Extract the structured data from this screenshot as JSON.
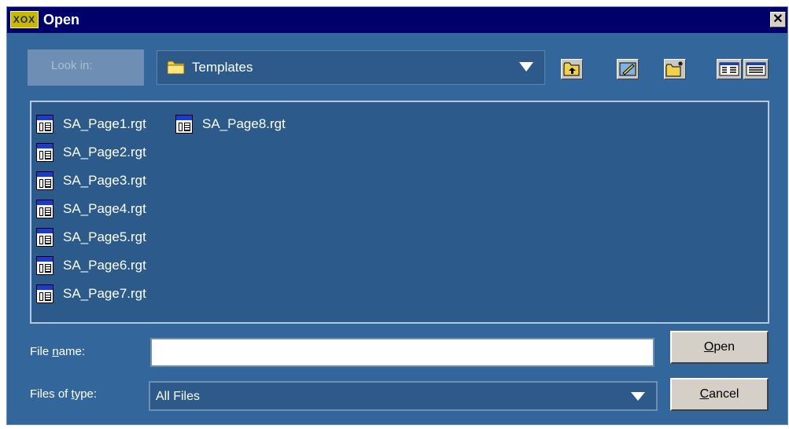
{
  "window": {
    "title": "Open",
    "app_icon_text": "XOX",
    "close_glyph": "✕"
  },
  "lookin": {
    "label": "Look in:",
    "value": "Templates",
    "icon": "folder-icon"
  },
  "toolbar": {
    "buttons": [
      "up-one-level-icon",
      "desktop-icon",
      "new-folder-icon",
      "list-view-icon",
      "details-view-icon"
    ]
  },
  "files": [
    {
      "name": "SA_Page1.rgt"
    },
    {
      "name": "SA_Page2.rgt"
    },
    {
      "name": "SA_Page3.rgt"
    },
    {
      "name": "SA_Page4.rgt"
    },
    {
      "name": "SA_Page5.rgt"
    },
    {
      "name": "SA_Page6.rgt"
    },
    {
      "name": "SA_Page7.rgt"
    },
    {
      "name": "SA_Page8.rgt"
    }
  ],
  "filename": {
    "label_pre": "File ",
    "label_u": "n",
    "label_post": "ame:",
    "value": ""
  },
  "filetype": {
    "label_pre": "Files of ",
    "label_u": "t",
    "label_post": "ype:",
    "value": "All Files"
  },
  "buttons": {
    "open_u": "O",
    "open_rest": "pen",
    "cancel_u": "C",
    "cancel_rest": "ancel"
  },
  "colors": {
    "titlebar": "#00006b",
    "dialog_bg": "#33669a",
    "list_bg": "#2b5a8b"
  }
}
